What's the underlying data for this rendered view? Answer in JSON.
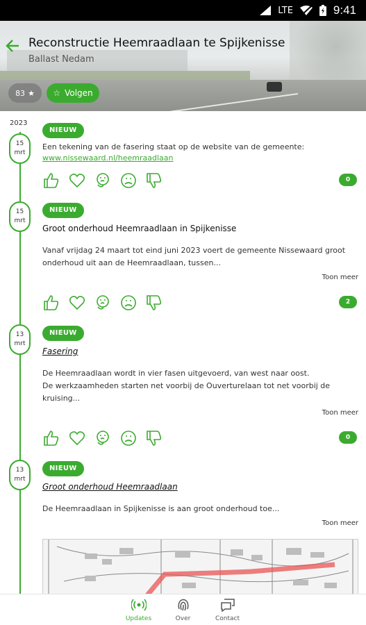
{
  "status_bar": {
    "network": "LTE",
    "time": "9:41"
  },
  "header": {
    "title": "Reconstructie Heemraadlaan te Spijkenisse",
    "subtitle": "Ballast Nedam",
    "followers": "83",
    "follow_label": "Volgen"
  },
  "timeline": {
    "year": "2023",
    "posts": [
      {
        "day": "15",
        "month": "mrt",
        "badge": "NIEUW",
        "text": "Een tekening van de fasering staat op de website van de gemeente:",
        "link": "www.nissewaard.nl/heemraadlaan",
        "reaction_count": "0"
      },
      {
        "day": "15",
        "month": "mrt",
        "badge": "NIEUW",
        "title": "Groot onderhoud Heemraadlaan in Spijkenisse",
        "text": "Vanaf vrijdag 24 maart tot eind juni 2023 voert de gemeente Nissewaard groot onderhoud uit aan de Heemraadlaan, tussen...",
        "more": "Toon meer",
        "reaction_count": "2"
      },
      {
        "day": "13",
        "month": "mrt",
        "badge": "NIEUW",
        "title": "Fasering",
        "text1": "De Heemraadlaan wordt in vier fasen uitgevoerd, van west naar oost.",
        "text2": "De werkzaamheden starten net voorbij de Ouverturelaan tot net voorbij de kruising...",
        "more": "Toon meer",
        "reaction_count": "0"
      },
      {
        "day": "13",
        "month": "mrt",
        "badge": "NIEUW",
        "title": "Groot onderhoud Heemraadlaan",
        "text": "De Heemraadlaan in Spijkenisse is aan groot onderhoud toe...",
        "more": "Toon meer"
      }
    ]
  },
  "reactions": [
    "thumbs-up-icon",
    "heart-icon",
    "thinking-icon",
    "sad-icon",
    "thumbs-down-icon"
  ],
  "bottom_nav": [
    {
      "label": "Updates",
      "icon": "broadcast-icon",
      "active": true
    },
    {
      "label": "Over",
      "icon": "fingerprint-icon",
      "active": false
    },
    {
      "label": "Contact",
      "icon": "chat-icon",
      "active": false
    }
  ],
  "colors": {
    "accent": "#3bab2f"
  }
}
